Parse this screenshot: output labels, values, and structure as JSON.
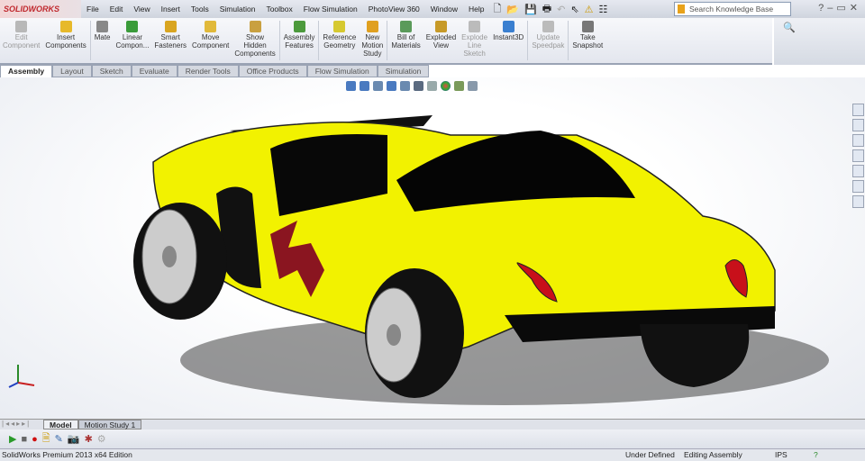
{
  "app": {
    "logo": "SOLIDWORKS"
  },
  "menu": [
    "File",
    "Edit",
    "View",
    "Insert",
    "Tools",
    "Simulation",
    "Toolbox",
    "Flow Simulation",
    "PhotoView 360",
    "Window",
    "Help"
  ],
  "search": {
    "placeholder": "Search Knowledge Base"
  },
  "commands": [
    {
      "label": "Edit\nComponent",
      "disabled": true,
      "color": "#b8b8b8"
    },
    {
      "label": "Insert\nComponents",
      "disabled": false,
      "color": "#e7b92a"
    },
    {
      "label": "Mate",
      "disabled": false,
      "color": "#888"
    },
    {
      "label": "Linear\nCompon...",
      "disabled": false,
      "color": "#3a9b3a"
    },
    {
      "label": "Smart\nFasteners",
      "disabled": false,
      "color": "#d9a520"
    },
    {
      "label": "Move\nComponent",
      "disabled": false,
      "color": "#e1b93a"
    },
    {
      "label": "Show\nHidden\nComponents",
      "disabled": false,
      "color": "#c9a040"
    },
    {
      "label": "Assembly\nFeatures",
      "disabled": false,
      "color": "#4c9a3c"
    },
    {
      "label": "Reference\nGeometry",
      "disabled": false,
      "color": "#d6c930"
    },
    {
      "label": "New\nMotion\nStudy",
      "disabled": false,
      "color": "#e0a020"
    },
    {
      "label": "Bill of\nMaterials",
      "disabled": false,
      "color": "#5a9a5a"
    },
    {
      "label": "Exploded\nView",
      "disabled": false,
      "color": "#c79a28"
    },
    {
      "label": "Explode\nLine\nSketch",
      "disabled": true,
      "color": "#bbb"
    },
    {
      "label": "Instant3D",
      "disabled": false,
      "color": "#3a7fd0"
    },
    {
      "label": "Update\nSpeedpak",
      "disabled": true,
      "color": "#bbb"
    },
    {
      "label": "Take\nSnapshot",
      "disabled": false,
      "color": "#777"
    }
  ],
  "tabs": [
    "Assembly",
    "Layout",
    "Sketch",
    "Evaluate",
    "Render Tools",
    "Office Products",
    "Flow Simulation",
    "Simulation"
  ],
  "bottom_tabs": [
    "Model",
    "Motion Study 1"
  ],
  "status": {
    "edition": "SolidWorks Premium 2013 x64 Edition",
    "defined": "Under Defined",
    "mode": "Editing Assembly",
    "units": "IPS"
  },
  "colors": {
    "body": "#f2f200",
    "taillight": "#c8101a",
    "logo": "#c0282d"
  }
}
